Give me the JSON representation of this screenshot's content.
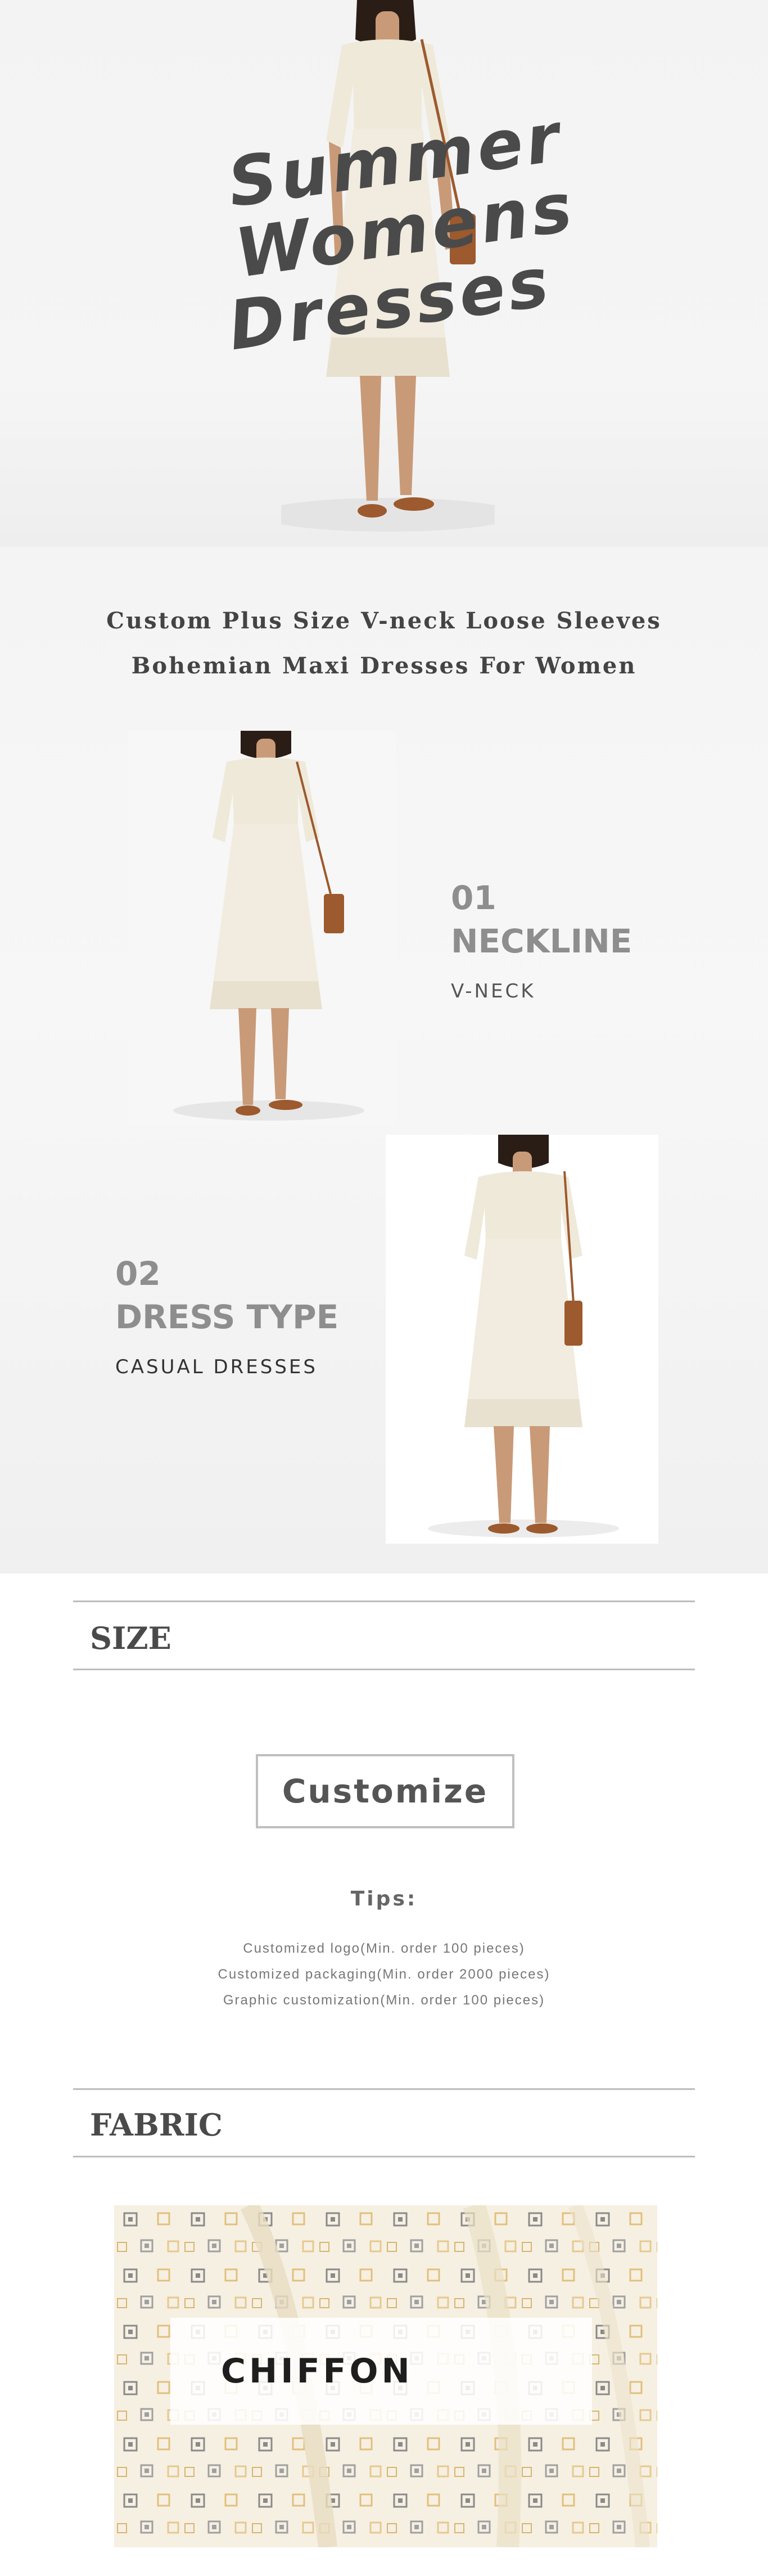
{
  "hero": {
    "title_line1": "Summer Womens",
    "title_line2": "Dresses"
  },
  "intro": {
    "line1": "Custom Plus Size V-neck Loose Sleeves",
    "line2": "Bohemian Maxi Dresses For Women"
  },
  "features": [
    {
      "number": "01",
      "title": "NECKLINE",
      "value": "V-NECK"
    },
    {
      "number": "02",
      "title": "DRESS TYPE",
      "value": "CASUAL DRESSES"
    }
  ],
  "size": {
    "heading": "SIZE",
    "button_label": "Customize",
    "tips_title": "Tips:",
    "tips": [
      "Customized logo(Min. order 100 pieces)",
      "Customized packaging(Min. order 2000 pieces)",
      "Graphic customization(Min. order 100 pieces)"
    ]
  },
  "fabric": {
    "heading": "FABRIC",
    "material": "CHIFFON"
  },
  "colors": {
    "title_gray": "#4a4a4a",
    "feature_gray": "#8e8e8e",
    "dress_cream": "#efe9da",
    "bag_brown": "#9c5a2e",
    "skin": "#c99a78",
    "hair": "#2a1d16"
  }
}
